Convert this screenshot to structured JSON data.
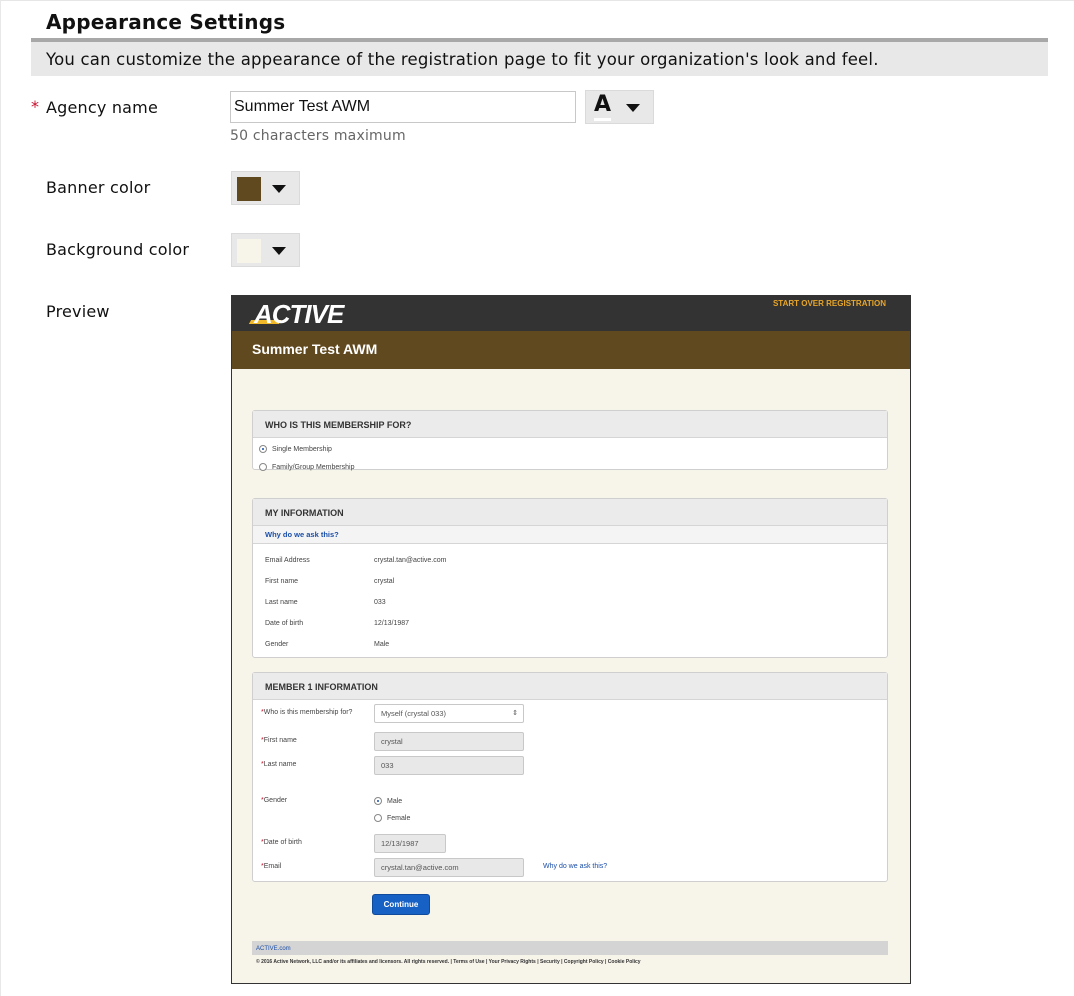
{
  "settings": {
    "title": "Appearance Settings",
    "description": "You can customize the appearance of the registration page to fit your organization's look and feel.",
    "agency_name_label": "Agency name",
    "agency_name_value": "Summer Test AWM",
    "agency_name_hint": "50 characters maximum",
    "required_marker": "*",
    "font_color_picker_glyph": "A",
    "banner_color_label": "Banner color",
    "banner_color": "#60481f",
    "background_color_label": "Background color",
    "background_color": "#f7f4ea",
    "preview_label": "Preview"
  },
  "preview": {
    "logo": "ACTIVE",
    "start_over": "START OVER REGISTRATION",
    "agency_name": "Summer Test AWM",
    "who_section": {
      "header": "WHO IS THIS MEMBERSHIP FOR?",
      "options": [
        "Single Membership",
        "Family/Group Membership"
      ]
    },
    "my_info": {
      "header": "MY INFORMATION",
      "why_link": "Why do we ask this?",
      "rows": [
        {
          "label": "Email Address",
          "value": "crystal.tan@active.com"
        },
        {
          "label": "First name",
          "value": "crystal"
        },
        {
          "label": "Last name",
          "value": "033"
        },
        {
          "label": "Date of birth",
          "value": "12/13/1987"
        },
        {
          "label": "Gender",
          "value": "Male"
        }
      ]
    },
    "member_info": {
      "header": "MEMBER 1 INFORMATION",
      "who_label": "Who is this membership for?",
      "who_value": "Myself (crystal 033)",
      "first_name_label": "First name",
      "first_name_value": "crystal",
      "last_name_label": "Last name",
      "last_name_value": "033",
      "gender_label": "Gender",
      "gender_options": [
        "Male",
        "Female"
      ],
      "dob_label": "Date of birth",
      "dob_value": "12/13/1987",
      "email_label": "Email",
      "email_value": "crystal.tan@active.com",
      "why_link": "Why do we ask this?"
    },
    "continue_label": "Continue",
    "footer_link": "ACTIVE.com",
    "footer_text": "© 2016 Active Network, LLC and/or its affiliates and licensors. All rights reserved. | Terms of Use | Your Privacy Rights | Security | Copyright Policy | Cookie Policy"
  }
}
